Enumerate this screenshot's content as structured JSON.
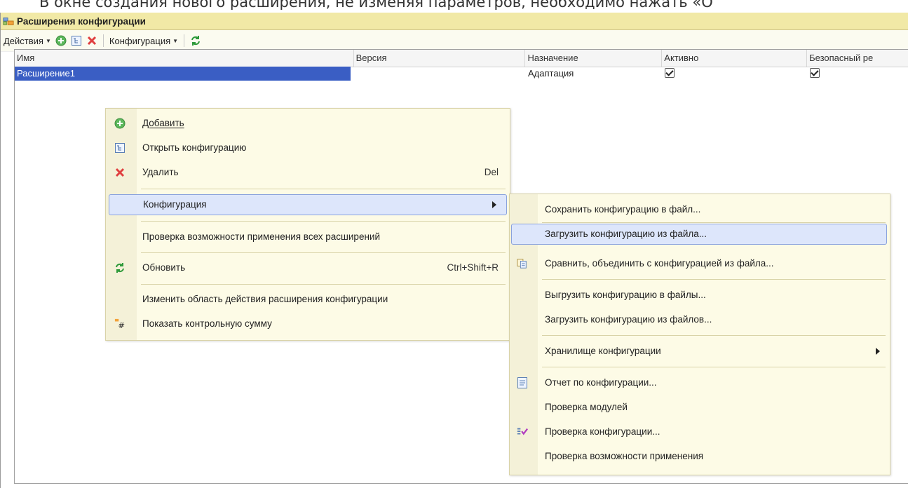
{
  "caption": "В окне создания нового расширения, не изменяя параметров, необходимо нажать «О",
  "window": {
    "title": "Расширения конфигурации"
  },
  "toolbar": {
    "actions_label": "Действия",
    "config_label": "Конфигурация"
  },
  "columns": [
    "Имя",
    "Версия",
    "Назначение",
    "Активно",
    "Безопасный ре"
  ],
  "row": {
    "name": "Расширение1",
    "version": "",
    "purpose": "Адаптация",
    "active": true,
    "safe": true
  },
  "context_menu": {
    "add": "Добавить",
    "open_config": "Открыть конфигурацию",
    "delete": "Удалить",
    "delete_shortcut": "Del",
    "configuration": "Конфигурация",
    "check_all": "Проверка возможности применения всех расширений",
    "refresh": "Обновить",
    "refresh_shortcut": "Ctrl+Shift+R",
    "change_scope": "Изменить область действия расширения конфигурации",
    "checksum": "Показать контрольную сумму"
  },
  "submenu": {
    "save_to_file": "Сохранить конфигурацию в файл...",
    "load_from_file": "Загрузить конфигурацию из файла...",
    "compare_merge": "Сравнить, объединить с конфигурацией из файла...",
    "dump_to_files": "Выгрузить конфигурацию в файлы...",
    "load_from_files": "Загрузить конфигурацию из файлов...",
    "repository": "Хранилище конфигурации",
    "report": "Отчет по конфигурации...",
    "check_modules": "Проверка модулей",
    "check_config": "Проверка конфигурации...",
    "check_apply": "Проверка возможности применения"
  },
  "colors": {
    "selection": "#3a5ec4",
    "menu_bg": "#fdfbe6",
    "title_bg": "#f1e9a6",
    "highlight": "#dde6fb"
  }
}
